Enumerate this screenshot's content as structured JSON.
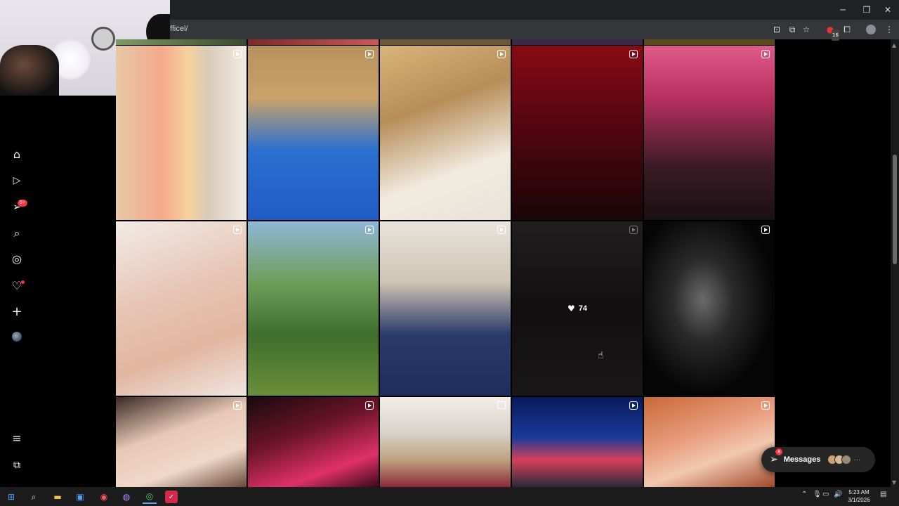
{
  "window": {
    "minimize": "─",
    "restore": "❐",
    "close": "✕",
    "url": "fficel/"
  },
  "toolbar": {
    "extension_badge": "16"
  },
  "sidebar": {
    "notification_badge": "9+"
  },
  "grid": {
    "hovered_likes": "74"
  },
  "messages": {
    "label": "Messages",
    "badge": "8",
    "more": "···"
  },
  "taskbar": {
    "time": "5:23 AM",
    "date": "3/1/2026"
  },
  "colors": {
    "accent_red": "#ff3040",
    "background": "#000000",
    "taskbar": "#1c1c1c",
    "browser_bar": "#35363a"
  }
}
